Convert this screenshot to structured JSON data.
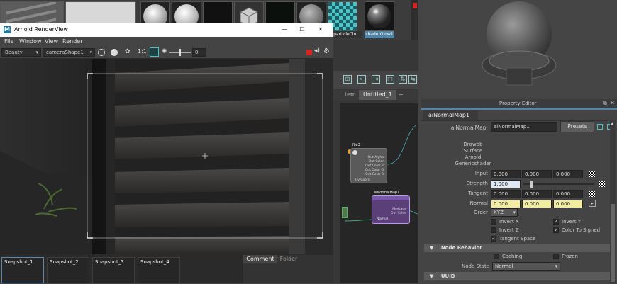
{
  "shelf": {
    "swatch_labels": [
      "",
      "",
      "",
      "",
      "",
      "",
      "particleClo...",
      "shaderGlow1",
      ""
    ]
  },
  "render_view": {
    "title": "Arnold RenderView",
    "window_controls": {
      "minimize": "—",
      "maximize": "☐",
      "close": "✕"
    },
    "menu": [
      "File",
      "Window",
      "View",
      "Render"
    ],
    "toolbar": {
      "aov": "Beauty",
      "camera": "cameraShape1",
      "ratio": "1:1",
      "exposure": "0"
    },
    "snapshots": [
      "Snapshot_1",
      "Snapshot_2",
      "Snapshot_3",
      "Snapshot_4"
    ],
    "tabs": [
      "Comment",
      "Folder"
    ]
  },
  "node_editor": {
    "tabs": [
      "tem",
      "Untitled_1",
      "+"
    ],
    "nodes": {
      "file_node": {
        "title": "file3",
        "ports": [
          "Out Alpha",
          "Out Color",
          "Out Color R",
          "Out Color G",
          "Out Color B"
        ],
        "input": "Uv Coord"
      },
      "normal_node": {
        "title": "aiNormalMap1",
        "ports": [
          "Message",
          "Out Value"
        ],
        "input": "Normal"
      }
    }
  },
  "property_editor": {
    "title": "Property Editor",
    "tab": "aiNormalMap1",
    "node_label": "aiNormalMap:",
    "node_name": "aiNormalMap1",
    "presets": "Presets",
    "classification": [
      "Drawdb",
      "Surface",
      "Arnold",
      "Genericshader"
    ],
    "attributes": {
      "input": {
        "label": "Input",
        "values": [
          "0.000",
          "0.000",
          "0.000"
        ]
      },
      "strength": {
        "label": "Strength",
        "value": "1.000",
        "fraction": 0.1
      },
      "tangent": {
        "label": "Tangent",
        "values": [
          "0.000",
          "0.000",
          "0.000"
        ]
      },
      "normal": {
        "label": "Normal",
        "values": [
          "0.000",
          "0.000",
          "0.000"
        ]
      },
      "order": {
        "label": "Order",
        "value": "XYZ"
      }
    },
    "checkboxes": {
      "invert_x": {
        "label": "Invert X",
        "checked": false
      },
      "invert_y": {
        "label": "Invert Y",
        "checked": true
      },
      "invert_z": {
        "label": "Invert Z",
        "checked": false
      },
      "color_to_signed": {
        "label": "Color To Signed",
        "checked": true
      },
      "tangent_space": {
        "label": "Tangent Space",
        "checked": true
      }
    },
    "node_behavior": {
      "header": "Node Behavior",
      "caching": "Caching",
      "frozen": "Frozen",
      "node_state_label": "Node State",
      "node_state": "Normal"
    },
    "uuid_header": "UUID"
  },
  "colors": {
    "panel": "#444444",
    "title_bar": "#ffffff",
    "highlight_field": "#f3ec9e",
    "selected_swatch": "#5285a6",
    "node_purple": "#5a3f78",
    "accent_cyan": "#4bc3c8",
    "record_red": "#d42525"
  }
}
